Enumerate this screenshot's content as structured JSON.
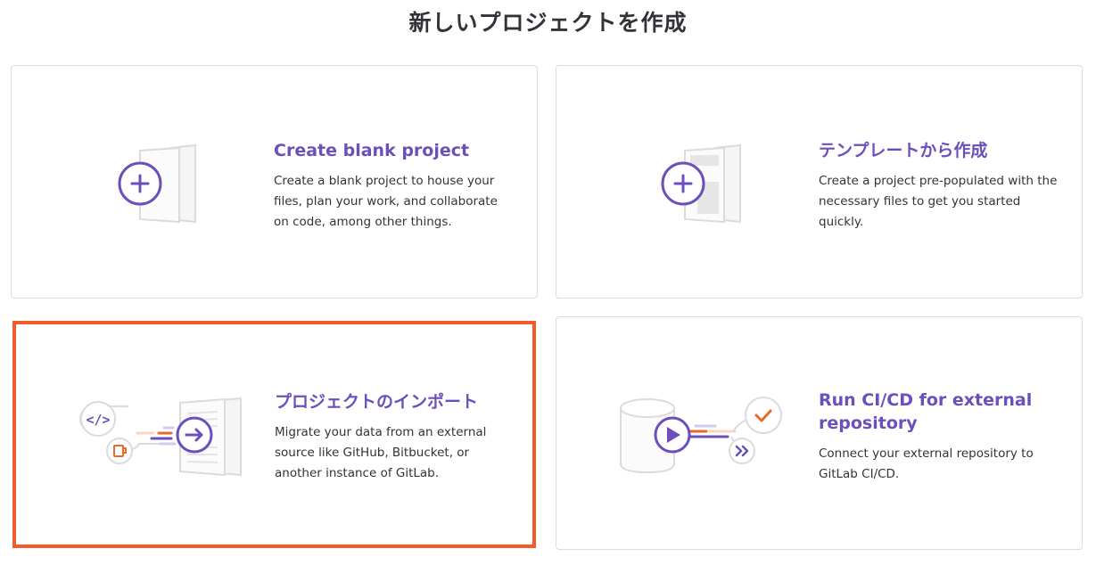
{
  "page": {
    "title": "新しいプロジェクトを作成"
  },
  "cards": [
    {
      "title": "Create blank project",
      "description": "Create a blank project to house your files, plan your work, and collaborate on code, among other things.",
      "icon": "blank-project-icon"
    },
    {
      "title": "テンプレートから作成",
      "description": "Create a project pre-populated with the necessary files to get you started quickly.",
      "icon": "template-project-icon"
    },
    {
      "title": "プロジェクトのインポート",
      "description": "Migrate your data from an external source like GitHub, Bitbucket, or another instance of GitLab.",
      "icon": "import-project-icon",
      "selected": true
    },
    {
      "title": "Run CI/CD for external repository",
      "description": "Connect your external repository to GitLab CI/CD.",
      "icon": "cicd-project-icon"
    }
  ],
  "colors": {
    "accent": "#6b4fbb",
    "highlight_border": "#f25c2b",
    "orange": "#e8682d",
    "border": "#dcdcde"
  }
}
